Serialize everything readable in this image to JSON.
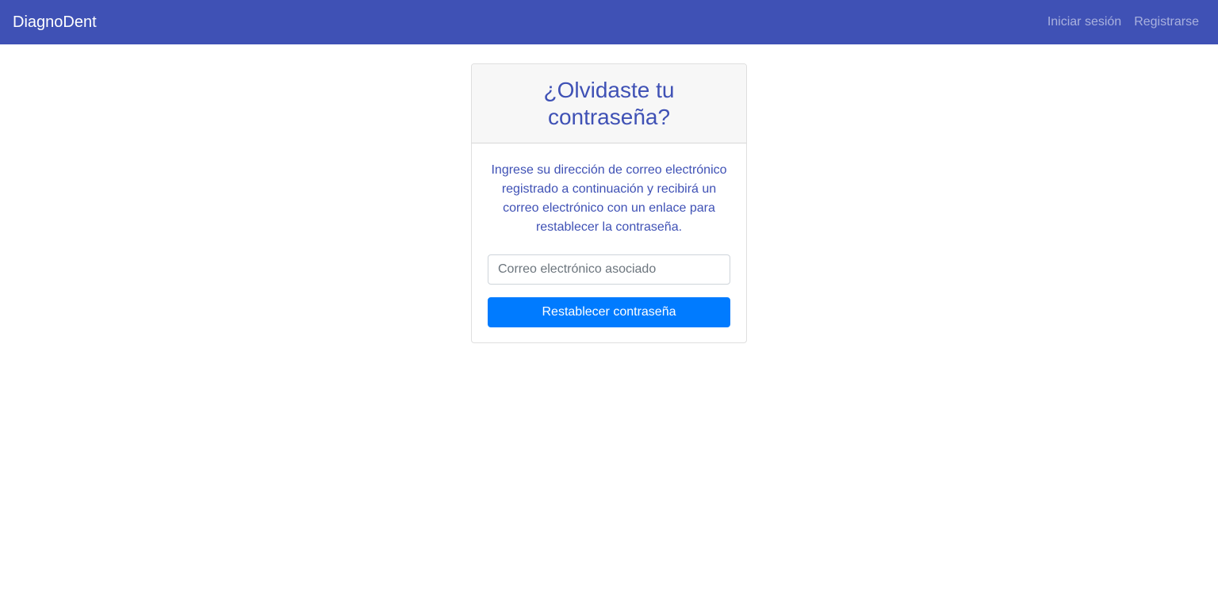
{
  "navbar": {
    "brand": "DiagnoDent",
    "links": [
      {
        "label": "Iniciar sesión"
      },
      {
        "label": "Registrarse"
      }
    ],
    "background_color": "#3f51b5"
  },
  "card": {
    "title": "¿Olvidaste tu contraseña?",
    "description": "Ingrese su dirección de correo electrónico registrado a continuación y recibirá un correo electrónico con un enlace para restablecer la contraseña.",
    "email_input": {
      "value": "",
      "placeholder": "Correo electrónico asociado"
    },
    "submit_label": "Restablecer contraseña",
    "accent_color": "#3f51b5",
    "button_color": "#007bff"
  }
}
